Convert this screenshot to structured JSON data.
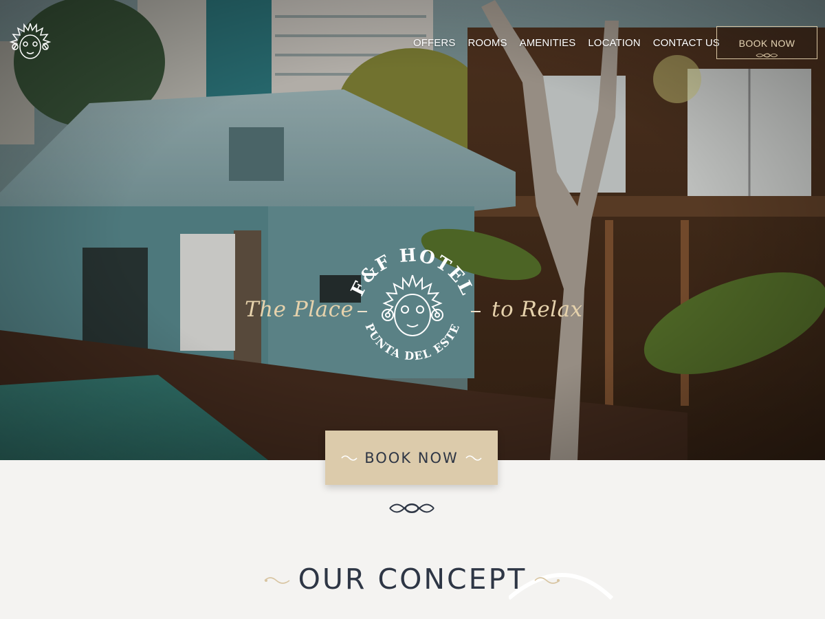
{
  "nav": {
    "items": [
      {
        "label": "OFFERS"
      },
      {
        "label": "ROOMS"
      },
      {
        "label": "AMENITIES"
      },
      {
        "label": "LOCATION"
      },
      {
        "label": "CONTACT US"
      }
    ],
    "book_label": "BOOK NOW"
  },
  "hero": {
    "emblem_top": "F&F HOTEL",
    "emblem_bottom": "PUNTA DEL ESTE",
    "tagline_left": "The Place",
    "tagline_right": "to Relax"
  },
  "cta": {
    "book_label": "BOOK NOW"
  },
  "concept": {
    "title": "OUR CONCEPT"
  },
  "colors": {
    "accent_gold": "#dccbab",
    "text_dark": "#2e3645",
    "background": "#f4f3f1"
  },
  "icons": [
    "sun-face-logo-icon",
    "flourish-ornament-icon",
    "wave-ornament-icon"
  ]
}
